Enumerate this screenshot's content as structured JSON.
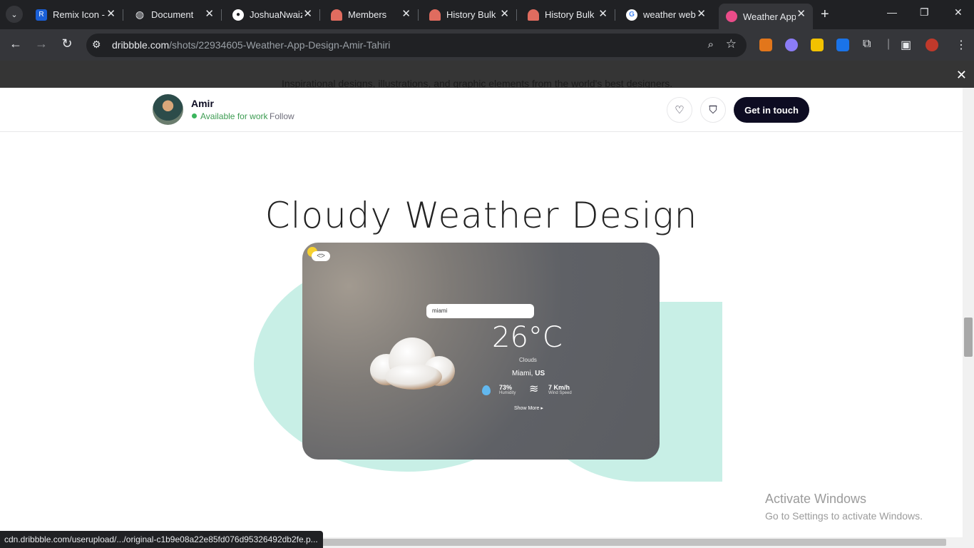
{
  "browser": {
    "tabs": [
      {
        "title": "Remix Icon -",
        "favicon": "remix-icon",
        "color": "#1a5fd6"
      },
      {
        "title": "Document",
        "favicon": "globe-icon",
        "color": "#5f6368"
      },
      {
        "title": "JoshuaNwaiz",
        "favicon": "github-icon",
        "color": "#ffffff"
      },
      {
        "title": "Members",
        "favicon": "hat-icon",
        "color": "#e06c5f"
      },
      {
        "title": "History Bulk",
        "favicon": "hat-icon",
        "color": "#e06c5f"
      },
      {
        "title": "History Bulk",
        "favicon": "hat-icon",
        "color": "#e06c5f"
      },
      {
        "title": "weather web",
        "favicon": "google-icon",
        "color": "#4285f4"
      },
      {
        "title": "Weather App",
        "favicon": "dribbble-icon",
        "color": "#ea4c89"
      }
    ],
    "url_host": "dribbble.com",
    "url_path": "/shots/22934605-Weather-App-Design-Amir-Tahiri",
    "status_url": "cdn.dribbble.com/userupload/.../original-c1b9e08a22e85fd076d95326492db2fe.p..."
  },
  "banner": {
    "text": "Inspirational designs, illustrations, and graphic elements from the world's best designers."
  },
  "shot": {
    "author": "Amir",
    "availability": "Available for work",
    "follow_label": "Follow",
    "cta_label": "Get in touch",
    "title": "Cloudy Weather Design",
    "colors": {
      "accent": "#0d0c22",
      "blob": "#c8efe6",
      "available": "#3bb55d"
    }
  },
  "weather_card": {
    "search_value": "miami",
    "temperature": "26°C",
    "condition": "Clouds",
    "city": "Miami,",
    "country": "US",
    "humidity_value": "73%",
    "humidity_label": "Humidity",
    "wind_value": "7 Km/h",
    "wind_label": "Wind Speed",
    "show_more": "Show More ▸"
  },
  "os": {
    "activate_title": "Activate Windows",
    "activate_sub": "Go to Settings to activate Windows."
  }
}
